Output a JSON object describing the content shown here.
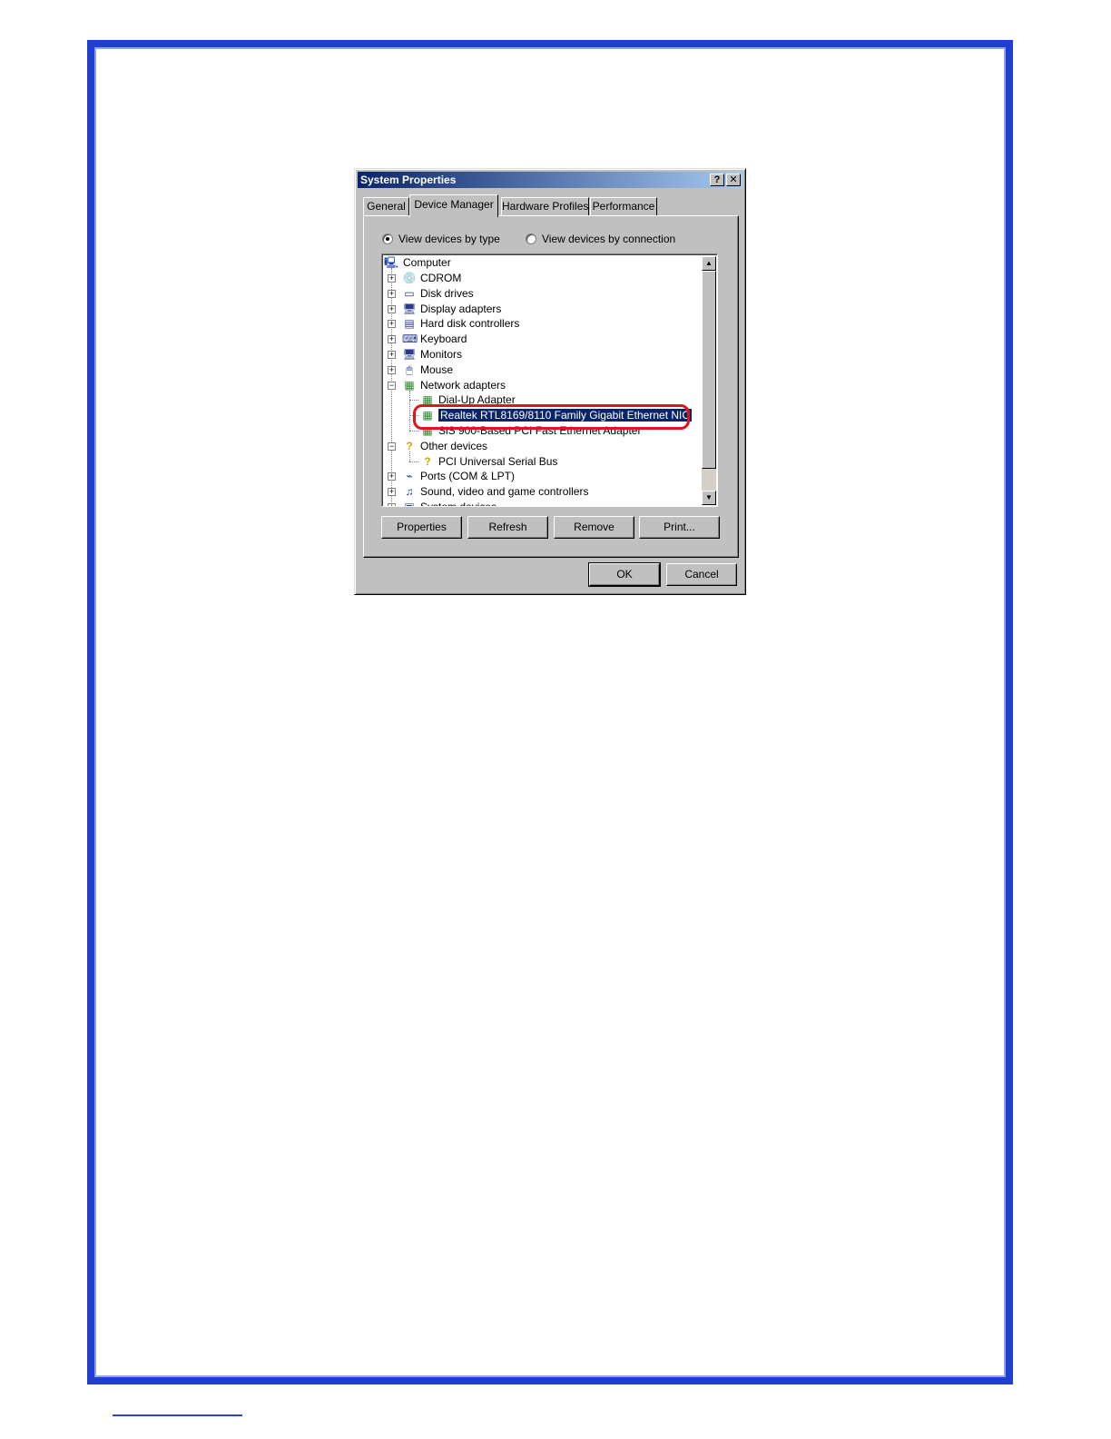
{
  "dialog": {
    "title": "System Properties",
    "help_glyph": "?",
    "close_glyph": "✕"
  },
  "tabs": [
    {
      "label": "General"
    },
    {
      "label": "Device Manager"
    },
    {
      "label": "Hardware Profiles"
    },
    {
      "label": "Performance"
    }
  ],
  "view_options": {
    "by_type": "View devices by type",
    "by_connection": "View devices by connection",
    "selected": "by_type"
  },
  "tree": {
    "root": "Computer",
    "items": [
      {
        "label": "CDROM",
        "icon": "cdrom-icon",
        "glyph": "💿",
        "expander": "+"
      },
      {
        "label": "Disk drives",
        "icon": "disk-drive-icon",
        "glyph": "▭",
        "expander": "+"
      },
      {
        "label": "Display adapters",
        "icon": "display-adapter-icon",
        "glyph": "🖥",
        "expander": "+"
      },
      {
        "label": "Hard disk controllers",
        "icon": "hard-disk-controller-icon",
        "glyph": "▤",
        "expander": "+"
      },
      {
        "label": "Keyboard",
        "icon": "keyboard-icon",
        "glyph": "⌨",
        "expander": "+"
      },
      {
        "label": "Monitors",
        "icon": "monitor-icon",
        "glyph": "🖥",
        "expander": "+"
      },
      {
        "label": "Mouse",
        "icon": "mouse-icon",
        "glyph": "🖱",
        "expander": "+"
      },
      {
        "label": "Network adapters",
        "icon": "network-adapter-icon",
        "glyph": "▦",
        "expander": "−"
      },
      {
        "label": "Dial-Up Adapter",
        "icon": "network-card-icon",
        "glyph": "▦",
        "child": true
      },
      {
        "label": "Realtek RTL8169/8110 Family Gigabit Ethernet NIC",
        "icon": "network-card-icon",
        "glyph": "▦",
        "child": true,
        "selected": true
      },
      {
        "label": "SiS 900-Based PCI Fast Ethernet Adapter",
        "icon": "network-card-icon",
        "glyph": "▦",
        "child": true
      },
      {
        "label": "Other devices",
        "icon": "question-mark-icon",
        "glyph": "?",
        "expander": "−"
      },
      {
        "label": "PCI Universal Serial Bus",
        "icon": "question-mark-icon",
        "glyph": "?",
        "child": true
      },
      {
        "label": "Ports (COM & LPT)",
        "icon": "port-icon",
        "glyph": "⌁",
        "expander": "+"
      },
      {
        "label": "Sound, video and game controllers",
        "icon": "sound-controller-icon",
        "glyph": "♫",
        "expander": "+"
      },
      {
        "label": "System devices",
        "icon": "system-device-icon",
        "glyph": "▣",
        "expander": "+"
      }
    ]
  },
  "scroll": {
    "up_glyph": "▲",
    "down_glyph": "▼"
  },
  "actions": {
    "properties": "Properties",
    "refresh": "Refresh",
    "remove": "Remove",
    "print": "Print..."
  },
  "footer_buttons": {
    "ok": "OK",
    "cancel": "Cancel"
  },
  "colors": {
    "page_frame": "#1e3fd0",
    "title_bar": "#0a246a",
    "selection": "#0a246a",
    "highlight_ring": "#e0141e"
  }
}
